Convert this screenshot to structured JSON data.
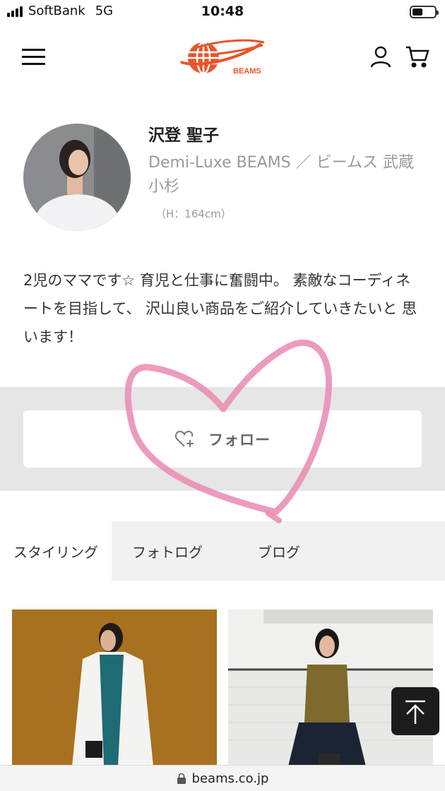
{
  "status_bar": {
    "carrier": "SoftBank",
    "network": "5G",
    "time": "10:48",
    "battery_level": 0.35
  },
  "header": {
    "menu_icon": "hamburger-menu-icon",
    "logo_text": "BEAMS",
    "brand_color": "#e8552b",
    "user_icon": "user-icon",
    "cart_icon": "cart-icon"
  },
  "profile": {
    "name": "沢登 聖子",
    "shop": "Demi-Luxe BEAMS ／ ビームス 武蔵小杉",
    "height": "（H：164cm）",
    "bio": "2児のママです☆ 育児と仕事に奮闘中。 素敵なコーディネートを目指して、 沢山良い商品をご紹介していきたいと 思います！"
  },
  "follow": {
    "icon": "heart-plus-icon",
    "label": "フォロー"
  },
  "tabs": [
    {
      "label": "スタイリング",
      "active": true
    },
    {
      "label": "フォトログ",
      "active": false
    },
    {
      "label": "ブログ",
      "active": false
    }
  ],
  "back_to_top_icon": "arrow-up-icon",
  "url_bar": {
    "lock_icon": "lock-icon",
    "url": "beams.co.jp"
  },
  "overlay": {
    "heart_color": "#e889b3"
  }
}
